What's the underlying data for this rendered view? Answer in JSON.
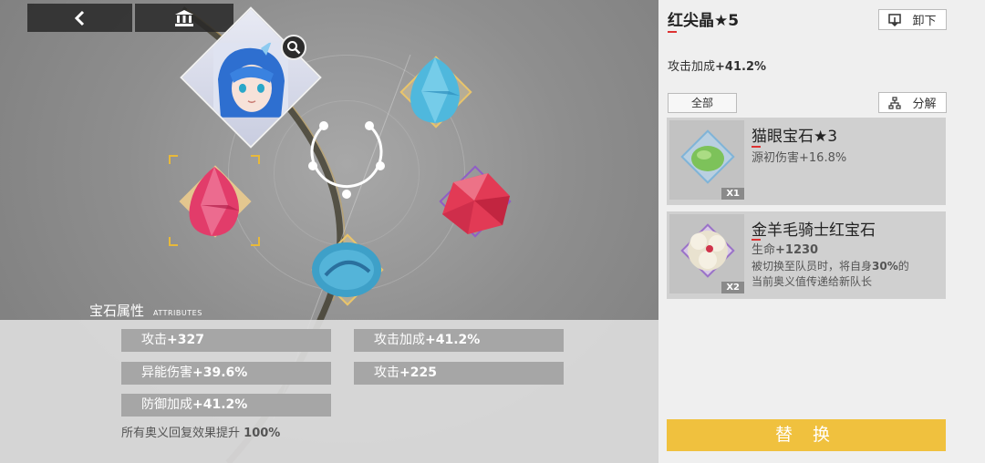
{
  "topbar": {
    "back_icon": "chevron-left-icon",
    "archive_icon": "archive-icon"
  },
  "attributes": {
    "title": "宝石属性",
    "subtitle": "ATTRIBUTES",
    "stats": [
      {
        "label": "攻击",
        "value": "+327"
      },
      {
        "label": "攻击加成",
        "value": "+41.2%"
      },
      {
        "label": "异能伤害",
        "value": "+39.6%"
      },
      {
        "label": "攻击",
        "value": "+225"
      },
      {
        "label": "防御加成",
        "value": "+41.2%"
      }
    ],
    "passive_label": "所有奥义回复效果提升",
    "passive_value": "100%"
  },
  "detail": {
    "name": "红尖晶★5",
    "stat_label": "攻击加成",
    "stat_value": "+41.2%",
    "unequip_label": "卸下",
    "filter_label": "全部",
    "decompose_label": "分解"
  },
  "inventory": [
    {
      "name": "猫眼宝石★3",
      "count": "X1",
      "line1_label": "源初伤害",
      "line1_value": "+16.8%"
    },
    {
      "name": "金羊毛骑士红宝石",
      "count": "X2",
      "line1_label": "生命",
      "line1_value": "+1230",
      "line2_a": "被切换至队员时，将自身",
      "line2_b": "30%",
      "line2_c": "的",
      "line3": "当前奥义值传递给新队长"
    }
  ],
  "replace_label": "替 换",
  "colors": {
    "accent": "#f0c13e",
    "red_mark": "#dd3333",
    "panel": "#efefef"
  }
}
